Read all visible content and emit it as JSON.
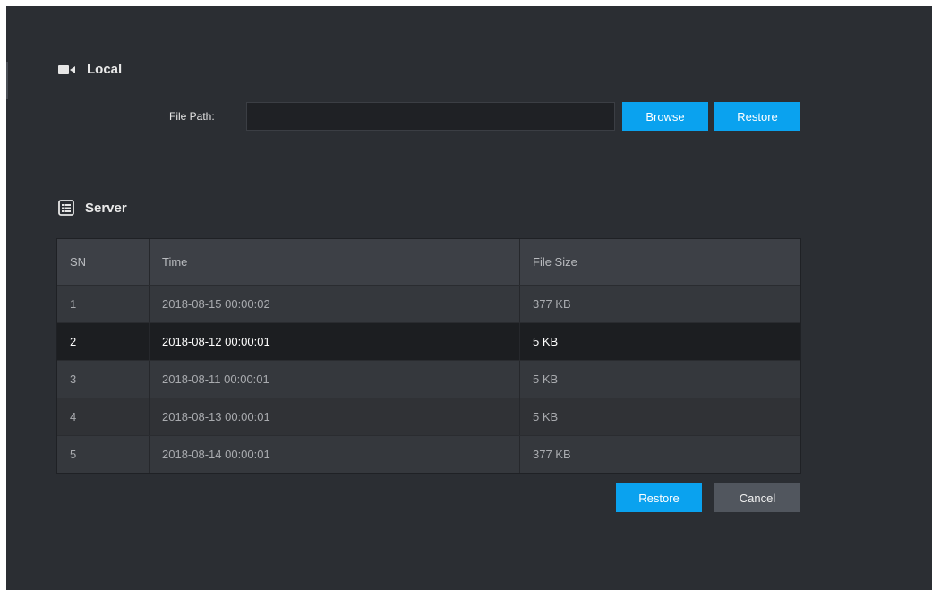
{
  "local": {
    "title": "Local",
    "file_path_label": "File Path:",
    "file_path_value": "",
    "browse_label": "Browse",
    "restore_label": "Restore"
  },
  "server": {
    "title": "Server",
    "columns": [
      "SN",
      "Time",
      "File Size"
    ],
    "rows": [
      {
        "sn": "1",
        "time": "2018-08-15 00:00:02",
        "size": "377 KB"
      },
      {
        "sn": "2",
        "time": "2018-08-12 00:00:01",
        "size": "5 KB"
      },
      {
        "sn": "3",
        "time": "2018-08-11 00:00:01",
        "size": "5 KB"
      },
      {
        "sn": "4",
        "time": "2018-08-13 00:00:01",
        "size": "5 KB"
      },
      {
        "sn": "5",
        "time": "2018-08-14 00:00:01",
        "size": "377 KB"
      }
    ],
    "selected_index": 1
  },
  "footer": {
    "restore_label": "Restore",
    "cancel_label": "Cancel"
  },
  "colors": {
    "accent": "#0aa2ef",
    "panel_bg": "#2b2e33",
    "secondary_button": "#51565e"
  },
  "icons": {
    "local": "video-camera-icon",
    "server": "list-icon"
  }
}
